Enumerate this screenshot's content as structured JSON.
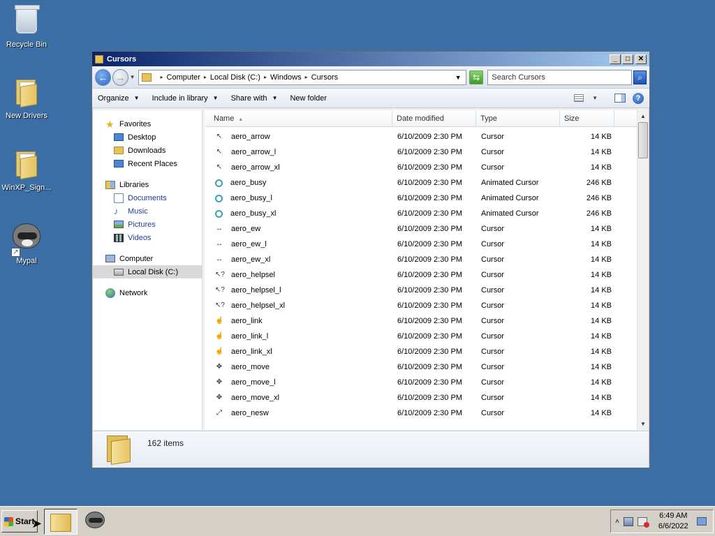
{
  "desktop": {
    "icons": [
      {
        "label": "Recycle Bin",
        "icon": "recycle-bin-icon"
      },
      {
        "label": "New Drivers",
        "icon": "folder-icon"
      },
      {
        "label": "WinXP_Sign...",
        "icon": "folder-icon"
      },
      {
        "label": "Mypal",
        "icon": "raccoon-app-icon"
      }
    ]
  },
  "window": {
    "title": "Cursors",
    "controls": {
      "minimize": "_",
      "maximize": "□",
      "close": "✕"
    },
    "address": {
      "crumbs": [
        "Computer",
        "Local Disk (C:)",
        "Windows",
        "Cursors"
      ]
    },
    "search": {
      "placeholder": "Search Cursors"
    },
    "commands": {
      "organize": "Organize",
      "include": "Include in library",
      "share": "Share with",
      "new_folder": "New folder"
    },
    "nav": {
      "favorites": "Favorites",
      "desktop": "Desktop",
      "downloads": "Downloads",
      "recent": "Recent Places",
      "libraries": "Libraries",
      "documents": "Documents",
      "music": "Music",
      "pictures": "Pictures",
      "videos": "Videos",
      "computer": "Computer",
      "local_disk": "Local Disk (C:)",
      "network": "Network"
    },
    "columns": {
      "name": "Name",
      "date": "Date modified",
      "type": "Type",
      "size": "Size"
    },
    "files": [
      {
        "name": "aero_arrow",
        "date": "6/10/2009 2:30 PM",
        "type": "Cursor",
        "size": "14 KB",
        "icon": "arrow-cursor-icon"
      },
      {
        "name": "aero_arrow_l",
        "date": "6/10/2009 2:30 PM",
        "type": "Cursor",
        "size": "14 KB",
        "icon": "arrow-cursor-icon"
      },
      {
        "name": "aero_arrow_xl",
        "date": "6/10/2009 2:30 PM",
        "type": "Cursor",
        "size": "14 KB",
        "icon": "arrow-cursor-icon"
      },
      {
        "name": "aero_busy",
        "date": "6/10/2009 2:30 PM",
        "type": "Animated Cursor",
        "size": "246 KB",
        "icon": "busy-cursor-icon"
      },
      {
        "name": "aero_busy_l",
        "date": "6/10/2009 2:30 PM",
        "type": "Animated Cursor",
        "size": "246 KB",
        "icon": "busy-cursor-icon"
      },
      {
        "name": "aero_busy_xl",
        "date": "6/10/2009 2:30 PM",
        "type": "Animated Cursor",
        "size": "246 KB",
        "icon": "busy-cursor-icon"
      },
      {
        "name": "aero_ew",
        "date": "6/10/2009 2:30 PM",
        "type": "Cursor",
        "size": "14 KB",
        "icon": "resize-ew-cursor-icon"
      },
      {
        "name": "aero_ew_l",
        "date": "6/10/2009 2:30 PM",
        "type": "Cursor",
        "size": "14 KB",
        "icon": "resize-ew-cursor-icon"
      },
      {
        "name": "aero_ew_xl",
        "date": "6/10/2009 2:30 PM",
        "type": "Cursor",
        "size": "14 KB",
        "icon": "resize-ew-cursor-icon"
      },
      {
        "name": "aero_helpsel",
        "date": "6/10/2009 2:30 PM",
        "type": "Cursor",
        "size": "14 KB",
        "icon": "help-cursor-icon"
      },
      {
        "name": "aero_helpsel_l",
        "date": "6/10/2009 2:30 PM",
        "type": "Cursor",
        "size": "14 KB",
        "icon": "help-cursor-icon"
      },
      {
        "name": "aero_helpsel_xl",
        "date": "6/10/2009 2:30 PM",
        "type": "Cursor",
        "size": "14 KB",
        "icon": "help-cursor-icon"
      },
      {
        "name": "aero_link",
        "date": "6/10/2009 2:30 PM",
        "type": "Cursor",
        "size": "14 KB",
        "icon": "hand-cursor-icon"
      },
      {
        "name": "aero_link_l",
        "date": "6/10/2009 2:30 PM",
        "type": "Cursor",
        "size": "14 KB",
        "icon": "hand-cursor-icon"
      },
      {
        "name": "aero_link_xl",
        "date": "6/10/2009 2:30 PM",
        "type": "Cursor",
        "size": "14 KB",
        "icon": "hand-cursor-icon"
      },
      {
        "name": "aero_move",
        "date": "6/10/2009 2:30 PM",
        "type": "Cursor",
        "size": "14 KB",
        "icon": "move-cursor-icon"
      },
      {
        "name": "aero_move_l",
        "date": "6/10/2009 2:30 PM",
        "type": "Cursor",
        "size": "14 KB",
        "icon": "move-cursor-icon"
      },
      {
        "name": "aero_move_xl",
        "date": "6/10/2009 2:30 PM",
        "type": "Cursor",
        "size": "14 KB",
        "icon": "move-cursor-icon"
      },
      {
        "name": "aero_nesw",
        "date": "6/10/2009 2:30 PM",
        "type": "Cursor",
        "size": "14 KB",
        "icon": "resize-nesw-cursor-icon"
      }
    ],
    "status": {
      "count": "162 items"
    }
  },
  "taskbar": {
    "start": "Start",
    "time": "6:49 AM",
    "date": "6/6/2022"
  }
}
